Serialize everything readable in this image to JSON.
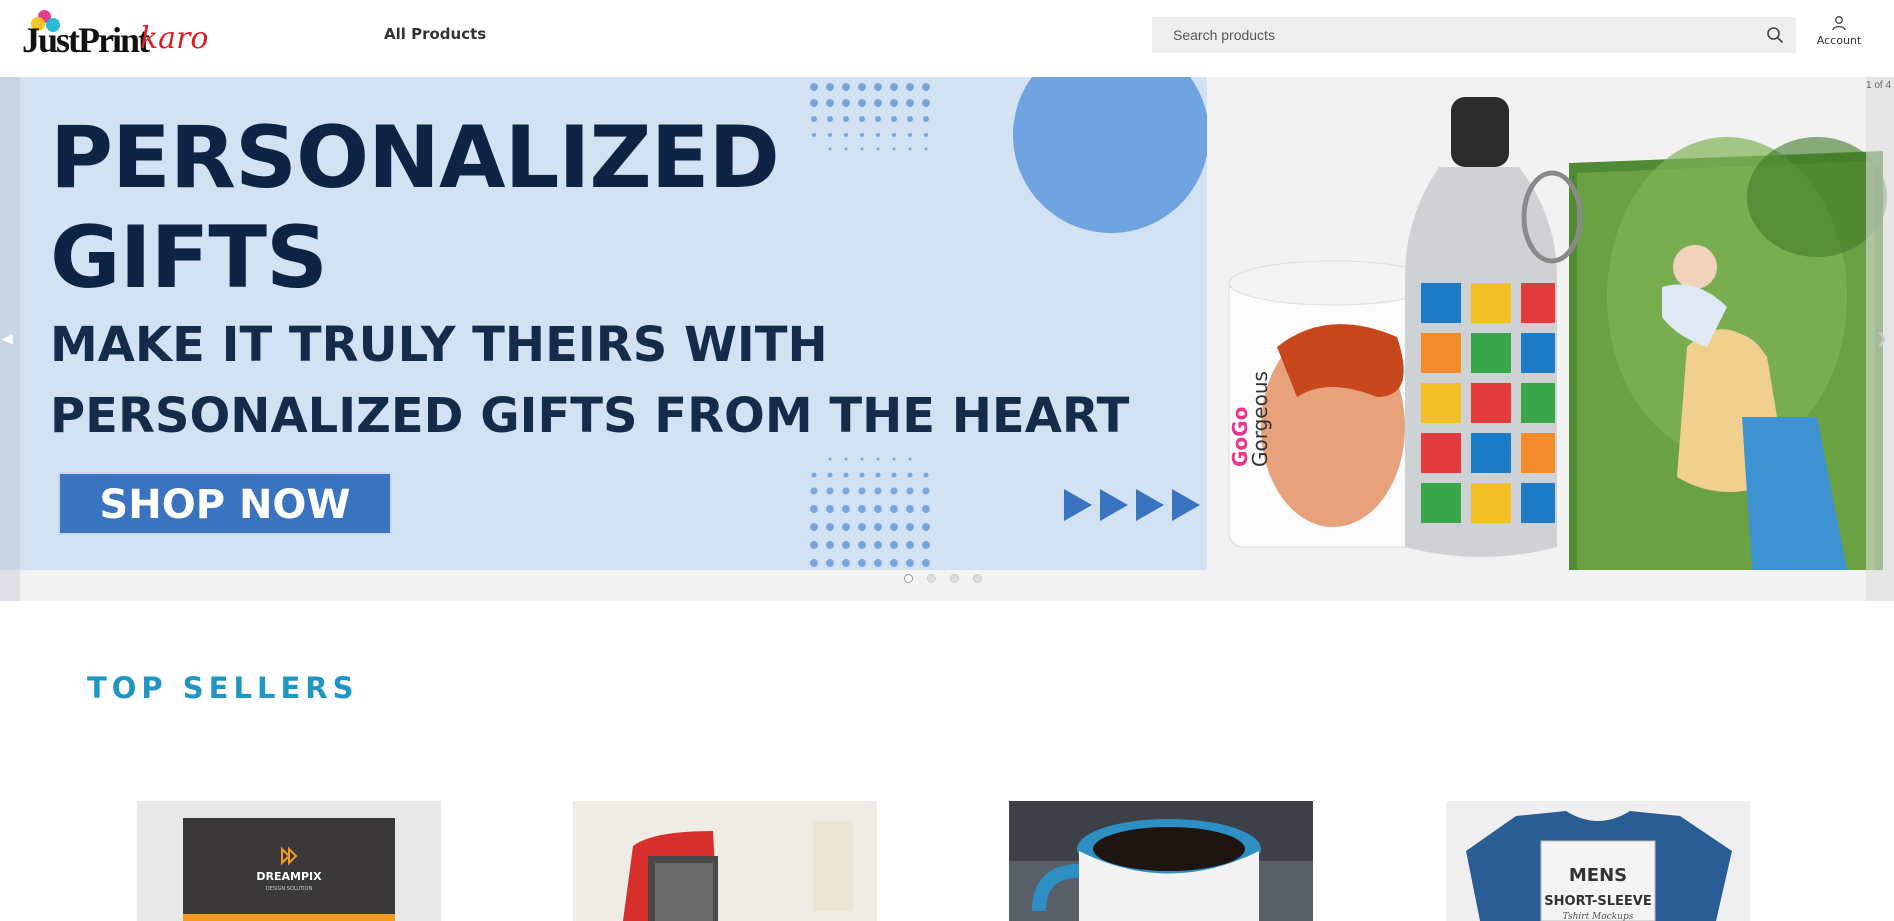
{
  "header": {
    "logo": {
      "main": "JustPrint",
      "accent": "karo"
    },
    "nav": {
      "all_products": "All Products"
    },
    "search": {
      "placeholder": "Search products"
    },
    "account_label": "Account"
  },
  "banner": {
    "counter": "1 of 4",
    "headline_line1": "PERSONALIZED",
    "headline_line2": "GIFTS",
    "sub_line1": "MAKE IT TRULY THEIRS WITH",
    "sub_line2": "PERSONALIZED GIFTS FROM THE HEART",
    "cta": "SHOP NOW",
    "mug_text_1": "GoGo",
    "mug_text_2": "Gorgeous",
    "slides": 4,
    "active_slide": 1
  },
  "top_sellers": {
    "title": "TOP SELLERS",
    "products": [
      {
        "name": "business-card",
        "brand": "DREAMPIX",
        "tagline": "DESIGN SOLUTION"
      },
      {
        "name": "rubber-stamp"
      },
      {
        "name": "coffee-mug"
      },
      {
        "name": "t-shirt",
        "tag_line1": "MENS",
        "tag_line2": "SHORT-SLEEVE",
        "tag_line3": "Tshirt Mockups"
      }
    ]
  },
  "colors": {
    "banner_bg": "#d3e2f3",
    "headline": "#0e2444",
    "cta": "#3a73bf",
    "accent_title": "#1f96c4",
    "logo_red": "#d91f26"
  }
}
